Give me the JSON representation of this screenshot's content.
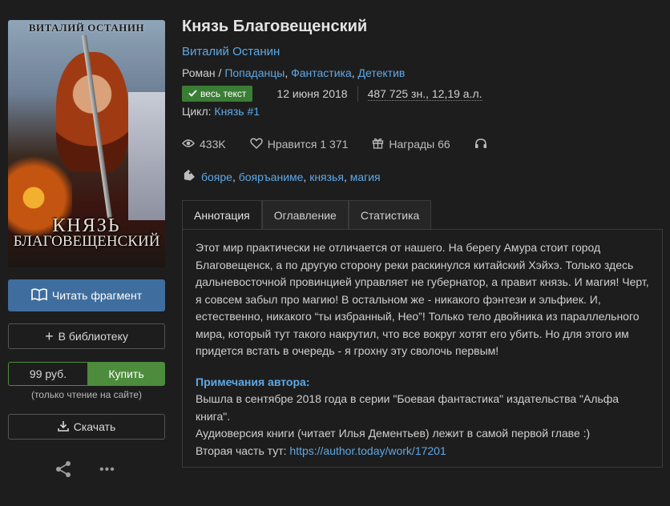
{
  "book": {
    "title": "Князь Благовещенский",
    "author": "Виталий Останин",
    "genres": [
      {
        "label": "Роман",
        "link": false
      },
      {
        "label": "Попаданцы",
        "link": true
      },
      {
        "label": "Фантастика",
        "link": true
      },
      {
        "label": "Детектив",
        "link": true
      }
    ],
    "status_badge": "весь текст",
    "date": "12 июня 2018",
    "size": "487 725 зн., 12,19 а.л.",
    "cycle_label": "Цикл:",
    "cycle_value": "Князь #1",
    "views": "433K",
    "likes": "Нравится 1 371",
    "awards": "Награды 66",
    "tags": [
      "бояре",
      "бояръаниме",
      "князья",
      "магия"
    ]
  },
  "cover": {
    "author": "ВИТАЛИЙ ОСТАНИН",
    "title_line1": "КНЯЗЬ",
    "title_line2": "БЛАГОВЕЩЕНСКИЙ"
  },
  "actions": {
    "read_fragment": "Читать фрагмент",
    "add_library": "В библиотеку",
    "price": "99 руб.",
    "buy": "Купить",
    "buy_note": "(только чтение на сайте)",
    "download": "Скачать"
  },
  "tabs": [
    "Аннотация",
    "Оглавление",
    "Статистика"
  ],
  "annotation": {
    "text": "Этот мир практически не отличается от нашего. На берегу Амура стоит город Благовещенск, а по другую сторону реки раскинулся китайский Хэйхэ. Только здесь дальневосточной провинцией управляет не губернатор, а правит князь. И магия! Черт, я совсем забыл про магию! В остальном же - никакого фэнтези и эльфиек. И, естественно, никакого “ты избранный, Нео”! Только тело двойника из параллельного мира, который тут такого накрутил, что все вокруг хотят его убить. Но для этого им придется встать в очередь - я грохну эту сволочь первым!",
    "notes_title": "Примечания автора:",
    "notes_line1": "Вышла в сентябре 2018 года в серии \"Боевая фантастика\" издательства \"Альфа книга\".",
    "notes_line2": "Аудиоверсия книги (читает Илья Дементьев) лежит в самой первой главе :)",
    "notes_line3_prefix": "Вторая часть тут: ",
    "notes_link": "https://author.today/work/17201"
  },
  "colors": {
    "background": "#1d1d1d",
    "link": "#5fa8e6",
    "primary_button": "#3f6e9e",
    "buy_green": "#4c8c3c",
    "badge_green": "#3a7d34"
  }
}
